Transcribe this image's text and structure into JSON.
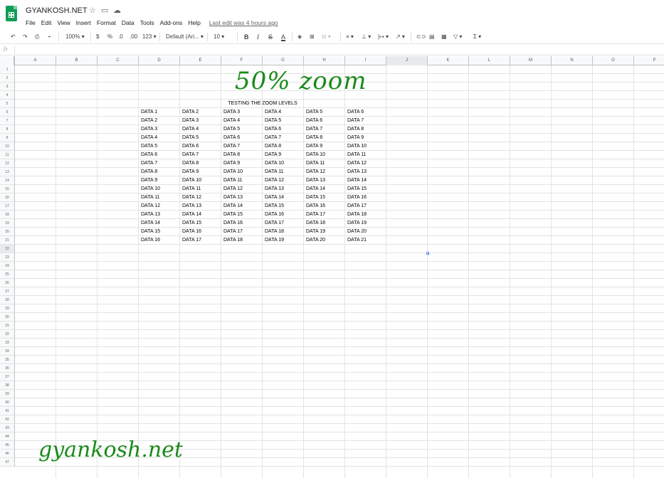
{
  "app": {
    "doc_title": "GYANKOSH.NET",
    "menus": [
      "File",
      "Edit",
      "View",
      "Insert",
      "Format",
      "Data",
      "Tools",
      "Add-ons",
      "Help"
    ],
    "last_edit": "Last edit was 4 hours ago"
  },
  "toolbar": {
    "zoom": "100%",
    "currency": "$",
    "percent": "%",
    "decrease_decimals": ".0",
    "increase_decimals": ".00",
    "more_formats": "123",
    "font": "Default (Ari...",
    "font_size": "10",
    "bold": "B",
    "italic": "I",
    "strikethrough": "S",
    "text_color": "A",
    "icons": [
      "undo-icon",
      "redo-icon",
      "print-icon",
      "paint-format-icon",
      "fill-color-icon",
      "borders-icon",
      "merge-icon",
      "align-icon",
      "valign-icon",
      "wrap-icon",
      "rotate-icon",
      "link-icon",
      "comment-icon",
      "chart-icon",
      "filter-icon",
      "functions-icon"
    ]
  },
  "formula_bar": {
    "fx": "fx",
    "value": ""
  },
  "columns": [
    "A",
    "B",
    "C",
    "D",
    "E",
    "F",
    "G",
    "H",
    "I",
    "J",
    "K",
    "L",
    "M",
    "N",
    "O",
    "P"
  ],
  "rows": [
    "1",
    "2",
    "3",
    "4",
    "5",
    "6",
    "7",
    "8",
    "9",
    "10",
    "11",
    "12",
    "13",
    "14",
    "15",
    "16",
    "17",
    "18",
    "19",
    "20",
    "21",
    "22",
    "23",
    "24",
    "25",
    "26",
    "27",
    "28",
    "29",
    "30",
    "31",
    "32",
    "33",
    "34",
    "35",
    "36",
    "37",
    "38",
    "39",
    "40",
    "41",
    "42",
    "43",
    "44",
    "45",
    "46",
    "47"
  ],
  "sheet": {
    "heading": "TESTING THE ZOOM LEVELS",
    "table": [
      [
        "DATA 1",
        "DATA 2",
        "DATA 3",
        "DATA 4",
        "DATA 5",
        "DATA 6"
      ],
      [
        "DATA 2",
        "DATA 3",
        "DATA 4",
        "DATA 5",
        "DATA 6",
        "DATA 7"
      ],
      [
        "DATA 3",
        "DATA 4",
        "DATA 5",
        "DATA 6",
        "DATA 7",
        "DATA 8"
      ],
      [
        "DATA 4",
        "DATA 5",
        "DATA 6",
        "DATA 7",
        "DATA 8",
        "DATA 9"
      ],
      [
        "DATA 5",
        "DATA 6",
        "DATA 7",
        "DATA 8",
        "DATA 9",
        "DATA 10"
      ],
      [
        "DATA 6",
        "DATA 7",
        "DATA 8",
        "DATA 9",
        "DATA 10",
        "DATA 11"
      ],
      [
        "DATA 7",
        "DATA 8",
        "DATA 9",
        "DATA 10",
        "DATA 11",
        "DATA 12"
      ],
      [
        "DATA 8",
        "DATA 9",
        "DATA 10",
        "DATA 11",
        "DATA 12",
        "DATA 13"
      ],
      [
        "DATA 9",
        "DATA 10",
        "DATA 11",
        "DATA 12",
        "DATA 13",
        "DATA 14"
      ],
      [
        "DATA 10",
        "DATA 11",
        "DATA 12",
        "DATA 13",
        "DATA 14",
        "DATA 15"
      ],
      [
        "DATA 11",
        "DATA 12",
        "DATA 13",
        "DATA 14",
        "DATA 15",
        "DATA 16"
      ],
      [
        "DATA 12",
        "DATA 13",
        "DATA 14",
        "DATA 15",
        "DATA 16",
        "DATA 17"
      ],
      [
        "DATA 13",
        "DATA 14",
        "DATA 15",
        "DATA 16",
        "DATA 17",
        "DATA 18"
      ],
      [
        "DATA 14",
        "DATA 15",
        "DATA 16",
        "DATA 17",
        "DATA 18",
        "DATA 19"
      ],
      [
        "DATA 15",
        "DATA 16",
        "DATA 17",
        "DATA 18",
        "DATA 19",
        "DATA 20"
      ],
      [
        "DATA 16",
        "DATA 17",
        "DATA 18",
        "DATA 19",
        "DATA 20",
        "DATA 21"
      ]
    ],
    "selected_column": "J",
    "selected_row": "22"
  },
  "overlays": {
    "zoom_caption": "50% zoom",
    "watermark": "gyankosh.net",
    "color": "#1a8a1a"
  }
}
